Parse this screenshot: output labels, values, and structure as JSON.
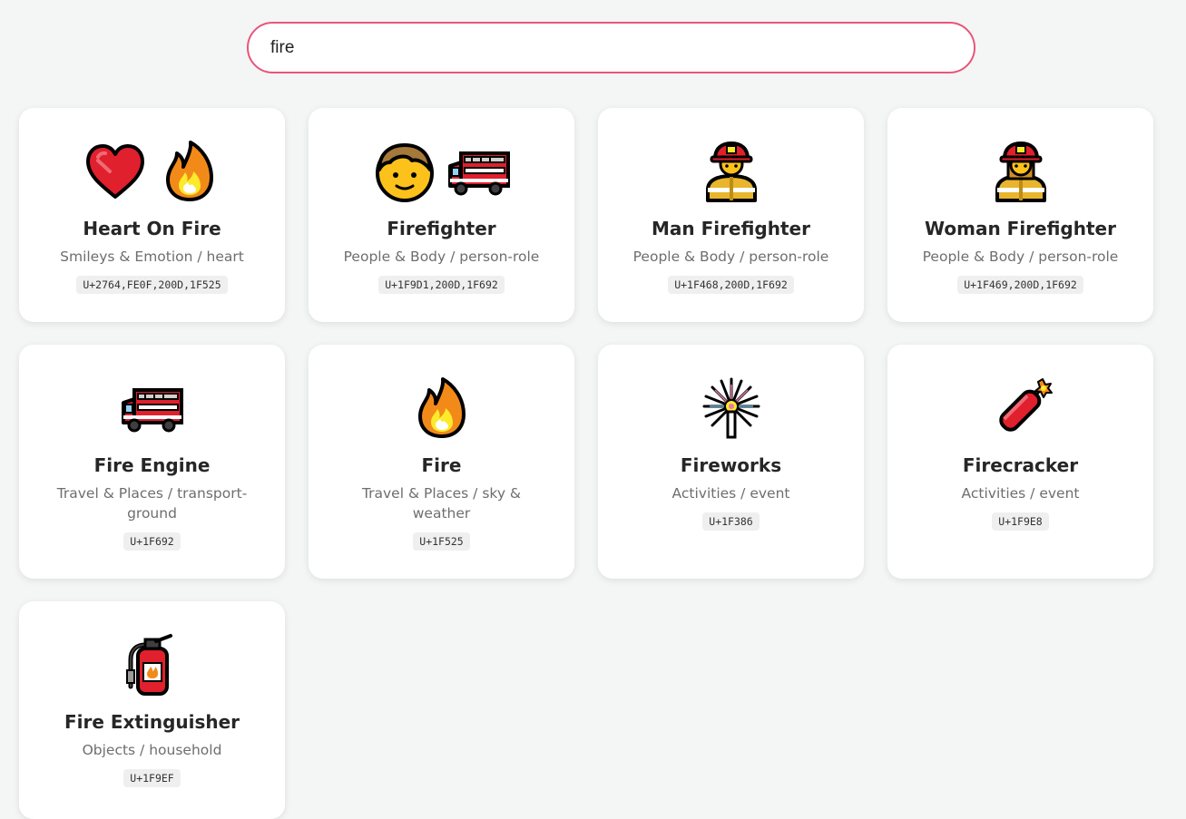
{
  "search": {
    "value": "fire"
  },
  "cards": [
    {
      "title": "Heart On Fire",
      "category": "Smileys & Emotion / heart",
      "code": "U+2764,FE0F,200D,1F525",
      "icons": [
        "heart-icon",
        "fire-icon"
      ]
    },
    {
      "title": "Firefighter",
      "category": "People & Body / person-role",
      "code": "U+1F9D1,200D,1F692",
      "icons": [
        "person-face-icon",
        "fire-engine-icon"
      ]
    },
    {
      "title": "Man Firefighter",
      "category": "People & Body / person-role",
      "code": "U+1F468,200D,1F692",
      "icons": [
        "man-firefighter-icon"
      ]
    },
    {
      "title": "Woman Firefighter",
      "category": "People & Body / person-role",
      "code": "U+1F469,200D,1F692",
      "icons": [
        "woman-firefighter-icon"
      ]
    },
    {
      "title": "Fire Engine",
      "category": "Travel & Places / transport-ground",
      "code": "U+1F692",
      "icons": [
        "fire-engine-icon"
      ]
    },
    {
      "title": "Fire",
      "category": "Travel & Places / sky & weather",
      "code": "U+1F525",
      "icons": [
        "fire-icon"
      ]
    },
    {
      "title": "Fireworks",
      "category": "Activities / event",
      "code": "U+1F386",
      "icons": [
        "fireworks-icon"
      ]
    },
    {
      "title": "Firecracker",
      "category": "Activities / event",
      "code": "U+1F9E8",
      "icons": [
        "firecracker-icon"
      ]
    },
    {
      "title": "Fire Extinguisher",
      "category": "Objects / household",
      "code": "U+1F9EF",
      "icons": [
        "fire-extinguisher-icon"
      ]
    }
  ]
}
